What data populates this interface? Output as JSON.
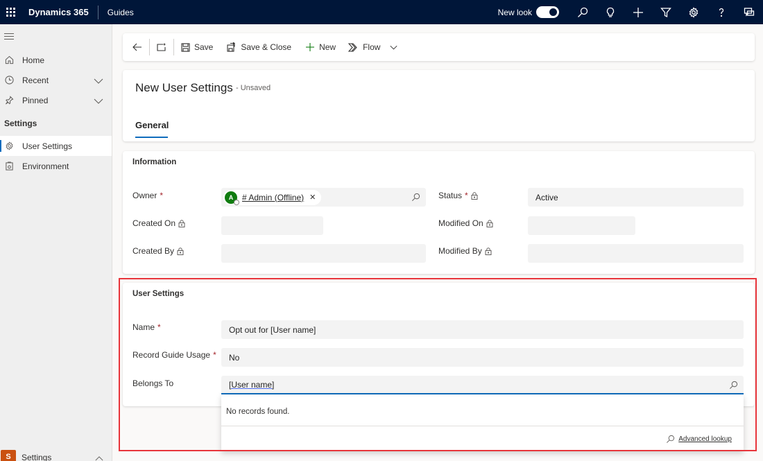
{
  "topbar": {
    "brand": "Dynamics 365",
    "app_name": "Guides",
    "new_look_label": "New look",
    "new_look_enabled": true
  },
  "sidebar": {
    "items": [
      {
        "label": "Home",
        "icon": "home-icon"
      },
      {
        "label": "Recent",
        "icon": "clock-icon",
        "expandable": true
      },
      {
        "label": "Pinned",
        "icon": "pin-icon",
        "expandable": true
      }
    ],
    "group_label": "Settings",
    "group_items": [
      {
        "label": "User Settings",
        "icon": "gear-icon",
        "active": true
      },
      {
        "label": "Environment",
        "icon": "environment-icon",
        "active": false
      }
    ],
    "area": {
      "badge": "S",
      "label": "Settings"
    }
  },
  "commandbar": {
    "save": "Save",
    "save_close": "Save & Close",
    "new": "New",
    "flow": "Flow"
  },
  "form": {
    "title": "New User Settings",
    "subtitle": "- Unsaved",
    "tabs": [
      {
        "label": "General",
        "active": true
      }
    ]
  },
  "information": {
    "title": "Information",
    "owner_label": "Owner",
    "owner_value": "# Admin (Offline)",
    "owner_initial": "A",
    "status_label": "Status",
    "status_value": "Active",
    "created_on_label": "Created On",
    "created_on_value": "",
    "modified_on_label": "Modified On",
    "modified_on_value": "",
    "created_by_label": "Created By",
    "created_by_value": "",
    "modified_by_label": "Modified By",
    "modified_by_value": "",
    "required_marker": "*"
  },
  "user_settings": {
    "title": "User Settings",
    "name_label": "Name",
    "name_value": "Opt out for [User name]",
    "record_label": "Record Guide Usage",
    "record_value": "No",
    "belongs_label": "Belongs To",
    "belongs_value": "[User name]",
    "required_marker": "*"
  },
  "lookup_dropdown": {
    "message": "No records found.",
    "advanced_lookup": "Advanced lookup"
  },
  "colors": {
    "topbar": "#001639",
    "accent": "#0f6cbd",
    "highlight": "#e8353b",
    "required": "#a4262c",
    "avatar": "#107c10",
    "area_badge": "#ca5010"
  }
}
